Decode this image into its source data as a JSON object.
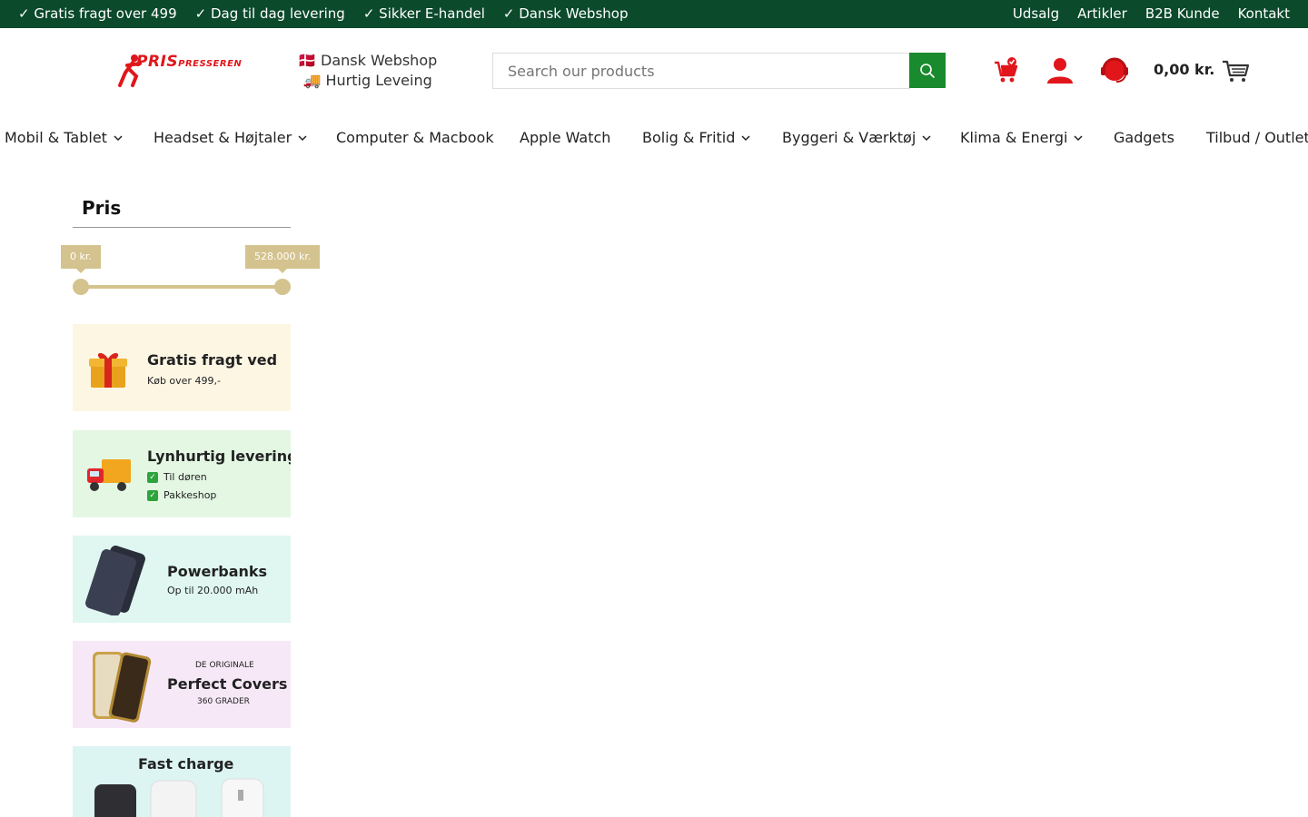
{
  "topbar": {
    "usps": [
      "✓ Gratis fragt over 499",
      "✓ Dag til dag levering",
      "✓ Sikker E-handel",
      "✓ Dansk Webshop"
    ],
    "links": [
      "Udsalg",
      "Artikler",
      "B2B Kunde",
      "Kontakt"
    ]
  },
  "header": {
    "logo_main": "PRIS",
    "logo_sub": "PRESSEREN",
    "tagline": [
      "🇩🇰 Dansk Webshop",
      "🚚 Hurtig Leveing"
    ],
    "search_placeholder": "Search our products",
    "cart_total": "0,00 kr."
  },
  "nav": [
    {
      "label": "Mobil & Tablet",
      "dropdown": true
    },
    {
      "label": "Headset & Højtaler",
      "dropdown": true
    },
    {
      "label": "Computer & Macbook",
      "dropdown": false
    },
    {
      "label": "Apple Watch",
      "dropdown": false
    },
    {
      "label": "Bolig & Fritid",
      "dropdown": true
    },
    {
      "label": "Byggeri & Værktøj",
      "dropdown": true
    },
    {
      "label": "Klima & Energi",
      "dropdown": true
    },
    {
      "label": "Gadgets",
      "dropdown": false
    },
    {
      "label": "Tilbud / Outlet",
      "dropdown": false
    }
  ],
  "filter": {
    "title": "Pris",
    "min_label": "0 kr.",
    "max_label": "528.000 kr."
  },
  "promos": [
    {
      "title": "Gratis fragt ved",
      "sub": "Køb over 499,-",
      "bg": "#fdf6e3",
      "icon": "gift-icon"
    },
    {
      "title": "Lynhurtig levering",
      "items": [
        "Til døren",
        "Pakkeshop"
      ],
      "bg": "#e3f7e3",
      "icon": "truck-icon"
    },
    {
      "title": "Powerbanks",
      "sub": "Op til 20.000 mAh",
      "bg": "#dff7f0",
      "icon": "powerbank-icon"
    },
    {
      "pre": "DE ORIGINALE",
      "title": "Perfect Covers",
      "sub": "360 GRADER",
      "bg": "#f6e8f6",
      "icon": "phone-cover-icon"
    },
    {
      "title": "Fast charge",
      "bg": "#dcf5f3",
      "icon": "charger-icon"
    }
  ],
  "colors": {
    "topbar": "#0b4a2b",
    "brand_red": "#e0161b",
    "search_button": "#1a8a2e",
    "slider": "#d4c38e"
  }
}
